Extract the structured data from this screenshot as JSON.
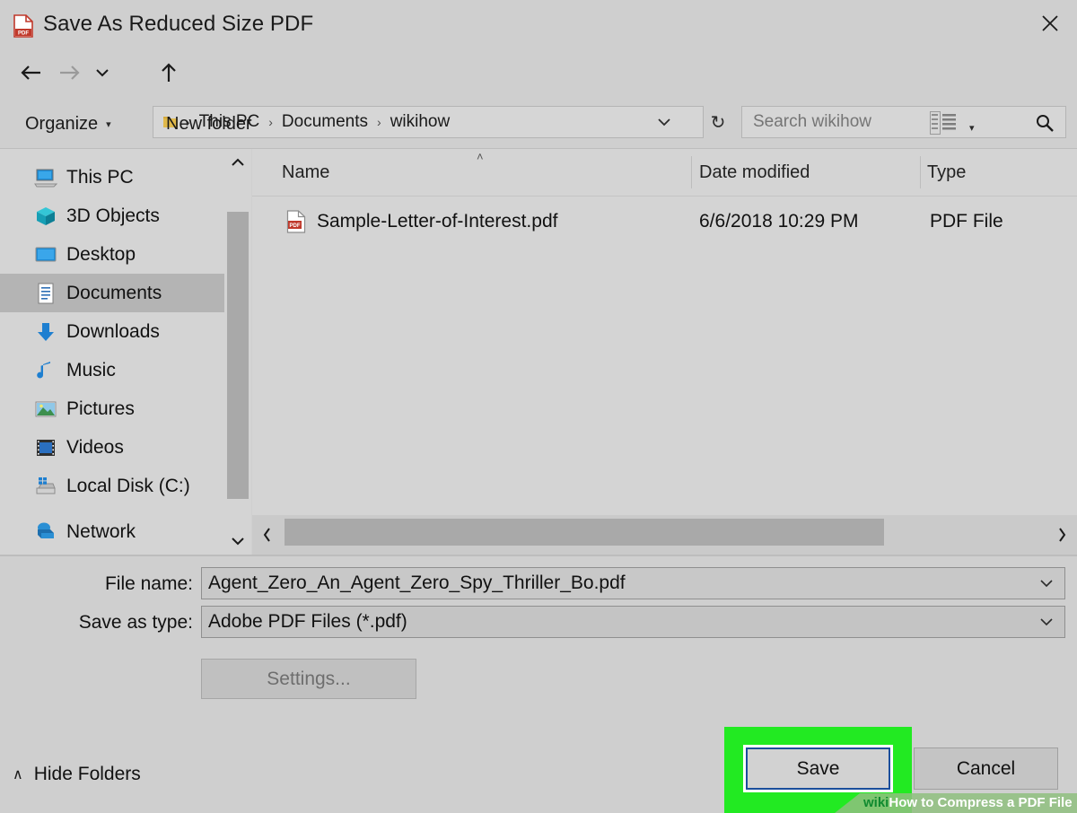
{
  "window": {
    "title": "Save As Reduced Size PDF",
    "title_icon": "pdf-file-icon",
    "close_label": "✕"
  },
  "nav": {
    "back_icon": "arrow-left-icon",
    "forward_icon": "arrow-right-icon",
    "recent_icon": "chevron-down-icon",
    "up_icon": "arrow-up-icon",
    "folder_icon": "folder-icon",
    "breadcrumbs": [
      "This PC",
      "Documents",
      "wikihow"
    ],
    "separator": "›",
    "dropdown_icon": "chevron-down-icon",
    "refresh_icon": "↻"
  },
  "search": {
    "placeholder": "Search wikihow",
    "value": "",
    "icon": "search-icon"
  },
  "toolbar": {
    "organize_label": "Organize",
    "organize_caret": "▾",
    "new_folder_label": "New folder",
    "view_icon": "list-view-icon",
    "view_caret": "▾",
    "help_label": "?"
  },
  "sidebar": {
    "items": [
      {
        "label": "This PC",
        "icon": "computer-icon",
        "selected": false
      },
      {
        "label": "3D Objects",
        "icon": "cube-icon",
        "selected": false
      },
      {
        "label": "Desktop",
        "icon": "desktop-icon",
        "selected": false
      },
      {
        "label": "Documents",
        "icon": "documents-icon",
        "selected": true
      },
      {
        "label": "Downloads",
        "icon": "download-icon",
        "selected": false
      },
      {
        "label": "Music",
        "icon": "music-note-icon",
        "selected": false
      },
      {
        "label": "Pictures",
        "icon": "picture-icon",
        "selected": false
      },
      {
        "label": "Videos",
        "icon": "film-icon",
        "selected": false
      },
      {
        "label": "Local Disk (C:)",
        "icon": "harddrive-icon",
        "selected": false
      },
      {
        "label": "Network",
        "icon": "network-icon",
        "selected": false
      }
    ],
    "scroll_up_icon": "chevron-up-icon",
    "scroll_down_icon": "chevron-down-icon"
  },
  "filelist": {
    "columns": [
      "Name",
      "Date modified",
      "Type"
    ],
    "sort_indicator": "˄",
    "rows": [
      {
        "name": "Sample-Letter-of-Interest.pdf",
        "date_modified": "6/6/2018 10:29 PM",
        "type": "PDF File",
        "icon": "pdf-file-icon"
      }
    ],
    "hscroll_left_icon": "‹",
    "hscroll_right_icon": "›"
  },
  "form": {
    "file_name_label": "File name:",
    "file_name_value": "Agent_Zero_An_Agent_Zero_Spy_Thriller_Bo.pdf",
    "save_type_label": "Save as type:",
    "save_type_value": "Adobe PDF Files (*.pdf)",
    "combo_arrow": "∨",
    "settings_label": "Settings...",
    "hide_folders_label": "Hide Folders",
    "hide_folders_caret": "∧",
    "save_label": "Save",
    "cancel_label": "Cancel"
  },
  "watermark": {
    "wiki": "wiki",
    "how": "How",
    "rest": " to Compress a PDF File"
  },
  "colors": {
    "dialog_background": "#cfcfcf",
    "panel_background": "#d4d4d4",
    "selection": "#b4b4b4",
    "accent_blue": "#1668ac",
    "highlight_green": "#22ea22",
    "focus_border": "#1b4f9c",
    "pdf_red": "#c0392b"
  }
}
